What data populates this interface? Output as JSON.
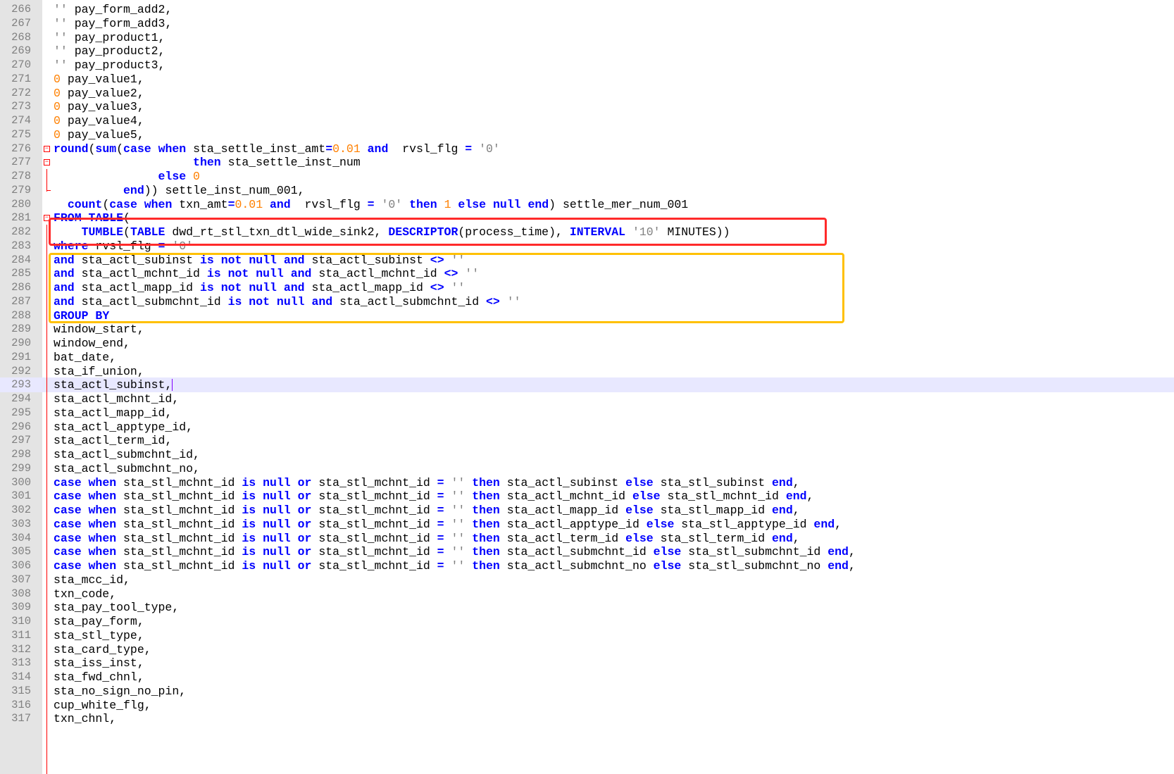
{
  "editor": {
    "lines": [
      {
        "n": "266",
        "code": "'' pay_form_add2,"
      },
      {
        "n": "267",
        "code": "'' pay_form_add3,"
      },
      {
        "n": "268",
        "code": "'' pay_product1,"
      },
      {
        "n": "269",
        "code": "'' pay_product2,"
      },
      {
        "n": "270",
        "code": "'' pay_product3,"
      },
      {
        "n": "271",
        "code": "0 pay_value1,"
      },
      {
        "n": "272",
        "code": "0 pay_value2,"
      },
      {
        "n": "273",
        "code": "0 pay_value3,"
      },
      {
        "n": "274",
        "code": "0 pay_value4,"
      },
      {
        "n": "275",
        "code": "0 pay_value5,"
      },
      {
        "n": "276",
        "code": "round(sum(case when sta_settle_inst_amt=0.01 and  rvsl_flg = '0'"
      },
      {
        "n": "277",
        "code": "                    then sta_settle_inst_num"
      },
      {
        "n": "278",
        "code": "               else 0"
      },
      {
        "n": "279",
        "code": "          end)) settle_inst_num_001,"
      },
      {
        "n": "280",
        "code": "  count(case when txn_amt=0.01 and  rvsl_flg = '0' then 1 else null end) settle_mer_num_001"
      },
      {
        "n": "281",
        "code": "FROM TABLE("
      },
      {
        "n": "282",
        "code": "    TUMBLE(TABLE dwd_rt_stl_txn_dtl_wide_sink2, DESCRIPTOR(process_time), INTERVAL '10' MINUTES))"
      },
      {
        "n": "283",
        "code": "where rvsl_flg = '0'"
      },
      {
        "n": "284",
        "code": "and sta_actl_subinst is not null and sta_actl_subinst <> ''"
      },
      {
        "n": "285",
        "code": "and sta_actl_mchnt_id is not null and sta_actl_mchnt_id <> ''"
      },
      {
        "n": "286",
        "code": "and sta_actl_mapp_id is not null and sta_actl_mapp_id <> ''"
      },
      {
        "n": "287",
        "code": "and sta_actl_submchnt_id is not null and sta_actl_submchnt_id <> ''"
      },
      {
        "n": "288",
        "code": "GROUP BY"
      },
      {
        "n": "289",
        "code": "window_start,"
      },
      {
        "n": "290",
        "code": "window_end,"
      },
      {
        "n": "291",
        "code": "bat_date,"
      },
      {
        "n": "292",
        "code": "sta_if_union,"
      },
      {
        "n": "293",
        "code": "sta_actl_subinst,"
      },
      {
        "n": "294",
        "code": "sta_actl_mchnt_id,"
      },
      {
        "n": "295",
        "code": "sta_actl_mapp_id,"
      },
      {
        "n": "296",
        "code": "sta_actl_apptype_id,"
      },
      {
        "n": "297",
        "code": "sta_actl_term_id,"
      },
      {
        "n": "298",
        "code": "sta_actl_submchnt_id,"
      },
      {
        "n": "299",
        "code": "sta_actl_submchnt_no,"
      },
      {
        "n": "300",
        "code": "case when sta_stl_mchnt_id is null or sta_stl_mchnt_id = '' then sta_actl_subinst else sta_stl_subinst end,"
      },
      {
        "n": "301",
        "code": "case when sta_stl_mchnt_id is null or sta_stl_mchnt_id = '' then sta_actl_mchnt_id else sta_stl_mchnt_id end,"
      },
      {
        "n": "302",
        "code": "case when sta_stl_mchnt_id is null or sta_stl_mchnt_id = '' then sta_actl_mapp_id else sta_stl_mapp_id end,"
      },
      {
        "n": "303",
        "code": "case when sta_stl_mchnt_id is null or sta_stl_mchnt_id = '' then sta_actl_apptype_id else sta_stl_apptype_id end,"
      },
      {
        "n": "304",
        "code": "case when sta_stl_mchnt_id is null or sta_stl_mchnt_id = '' then sta_actl_term_id else sta_stl_term_id end,"
      },
      {
        "n": "305",
        "code": "case when sta_stl_mchnt_id is null or sta_stl_mchnt_id = '' then sta_actl_submchnt_id else sta_stl_submchnt_id end,"
      },
      {
        "n": "306",
        "code": "case when sta_stl_mchnt_id is null or sta_stl_mchnt_id = '' then sta_actl_submchnt_no else sta_stl_submchnt_no end,"
      },
      {
        "n": "307",
        "code": "sta_mcc_id,"
      },
      {
        "n": "308",
        "code": "txn_code,"
      },
      {
        "n": "309",
        "code": "sta_pay_tool_type,"
      },
      {
        "n": "310",
        "code": "sta_pay_form,"
      },
      {
        "n": "311",
        "code": "sta_stl_type,"
      },
      {
        "n": "312",
        "code": "sta_card_type,"
      },
      {
        "n": "313",
        "code": "sta_iss_inst,"
      },
      {
        "n": "314",
        "code": "sta_fwd_chnl,"
      },
      {
        "n": "315",
        "code": "sta_no_sign_no_pin,"
      },
      {
        "n": "316",
        "code": "cup_white_flg,"
      },
      {
        "n": "317",
        "code": "txn_chnl,"
      }
    ],
    "current_line": "293",
    "colors": {
      "keyword": "#0000ff",
      "number": "#ff8000",
      "string": "#808080",
      "function": "#8000ff",
      "highlight_red": "#ff2a2a",
      "highlight_yellow": "#ffc000",
      "current_line_bg": "#e8e8ff"
    }
  }
}
